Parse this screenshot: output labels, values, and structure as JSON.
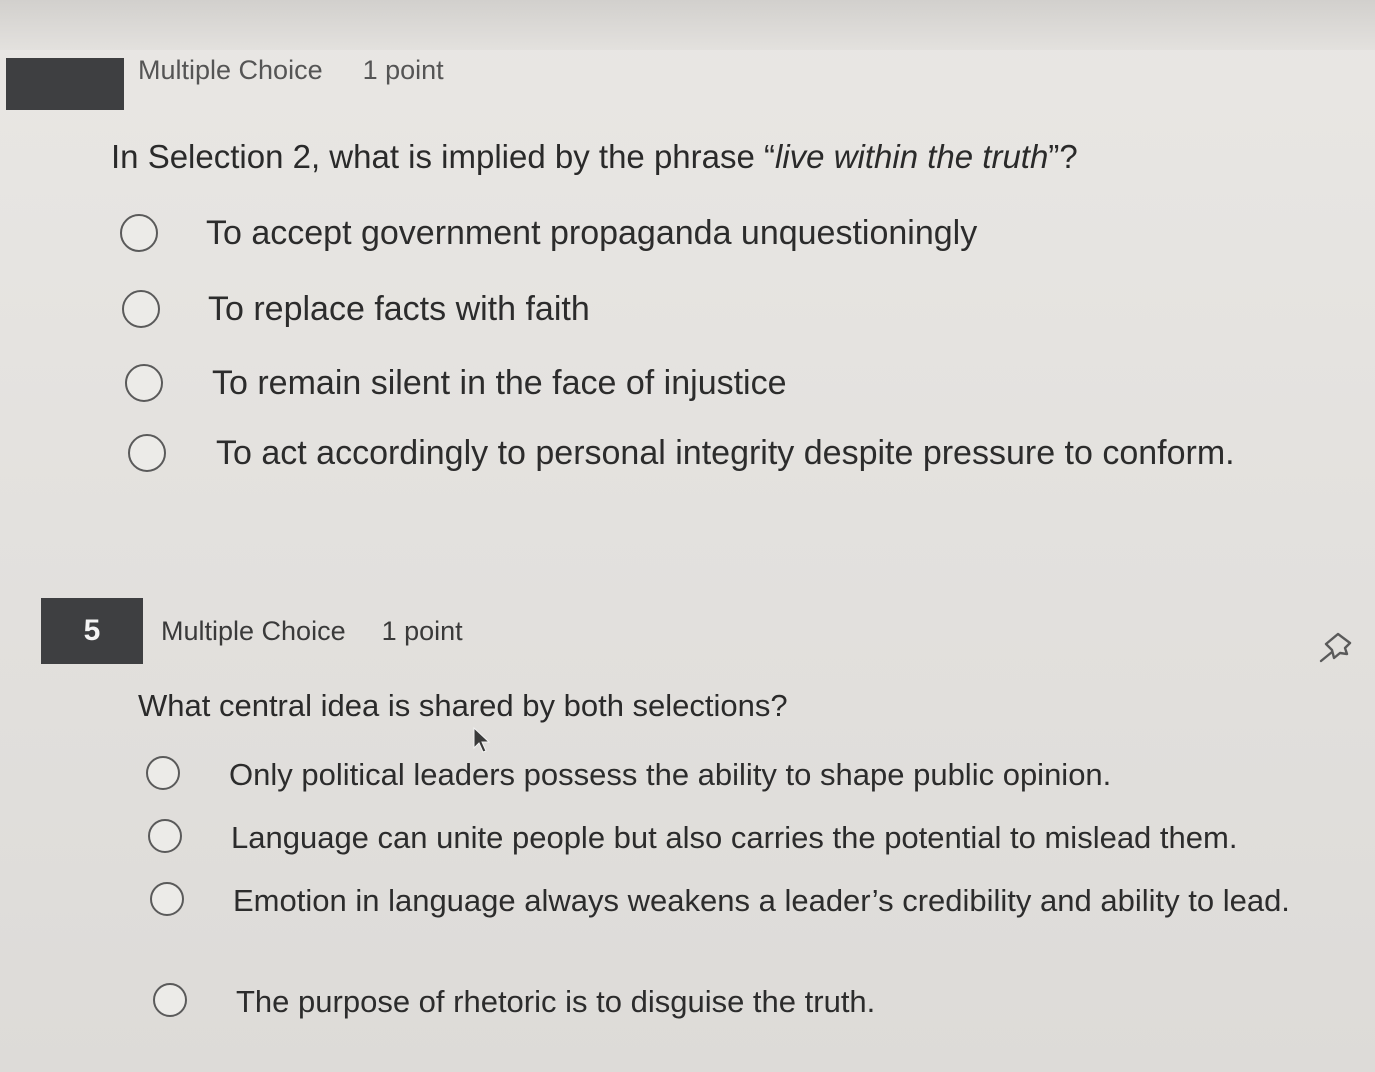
{
  "previous_question": {
    "header_type": "Multiple Choice",
    "header_points": "1 point",
    "prompt_before": "In Selection 2, what is implied by the phrase “",
    "prompt_emphasis": "live within the truth",
    "prompt_after": "”?",
    "options": [
      "To accept government propaganda unquestioningly",
      "To replace facts with faith",
      "To remain silent in the face of injustice",
      "To act accordingly to personal integrity despite pressure to conform."
    ]
  },
  "question_5": {
    "number": "5",
    "type": "Multiple Choice",
    "points": "1 point",
    "prompt": "What central idea is shared by both selections?",
    "options": [
      "Only political leaders possess the ability to shape public opinion.",
      "Language can unite people but also carries the potential to mislead them.",
      "Emotion in language always weakens a leader’s credibility and ability to lead.",
      "The purpose of rhetoric is to disguise the truth."
    ]
  },
  "icons": {
    "pin": "pin-icon",
    "cursor": "mouse-cursor-icon"
  }
}
